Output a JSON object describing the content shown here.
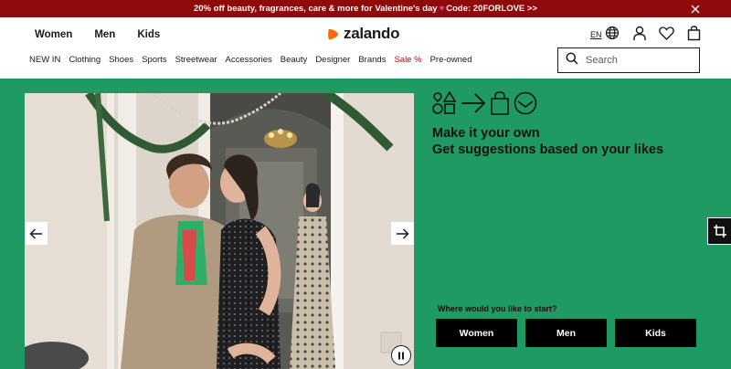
{
  "promo": {
    "text_before": "20% off beauty, fragrances, care & more for Valentine's day",
    "text_after": "Code: 20FORLOVE >>"
  },
  "header": {
    "gender_tabs": [
      "Women",
      "Men",
      "Kids"
    ],
    "logo_text": "zalando",
    "lang": "EN"
  },
  "categories": [
    "NEW IN",
    "Clothing",
    "Shoes",
    "Sports",
    "Streetwear",
    "Accessories",
    "Beauty",
    "Designer",
    "Brands",
    "Sale %",
    "Pre-owned"
  ],
  "search": {
    "placeholder": "Search"
  },
  "hero": {
    "heading_line1": "Make it your own",
    "heading_line2": "Get suggestions based on your likes",
    "start_label": "Where would you like to start?",
    "buttons": [
      "Women",
      "Men",
      "Kids"
    ]
  },
  "colors": {
    "promo_bg": "#8f0a0a",
    "hero_bg": "#1f9a63",
    "brand_orange": "#ff6900",
    "sale_red": "#d0021b"
  },
  "icons": [
    "close-icon",
    "globe-icon",
    "user-icon",
    "heart-icon",
    "bag-icon",
    "search-icon",
    "arrow-left-icon",
    "arrow-right-icon",
    "pause-icon",
    "shapes-icon",
    "arrow-icon",
    "shopping-bag-icon",
    "smile-icon",
    "crop-icon"
  ]
}
